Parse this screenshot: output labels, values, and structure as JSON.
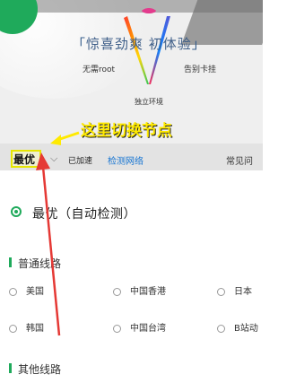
{
  "banner": {
    "slogan_main": "惊喜劲爽  初体验",
    "bracket_left": "「",
    "bracket_right": "」",
    "sub_left": "无需root",
    "sub_right": "告别卡挂",
    "bottom": "独立环境"
  },
  "callout": {
    "text": "这里切换节点"
  },
  "toolbar": {
    "selected": "最优",
    "accel_label": "已加速",
    "detect_link": "检测网络",
    "faq": "常见问"
  },
  "panel": {
    "best_option": "最优（自动检测）",
    "section_normal": "普通线路",
    "section_other": "其他线路",
    "normal_options": [
      "美国",
      "中国香港",
      "日本",
      "韩国",
      "中国台湾",
      "B站动"
    ]
  },
  "colors": {
    "accent_green": "#1faa5b",
    "link_blue": "#1976d2",
    "callout_yellow": "#ffea00",
    "arrow_red": "#e53935"
  }
}
